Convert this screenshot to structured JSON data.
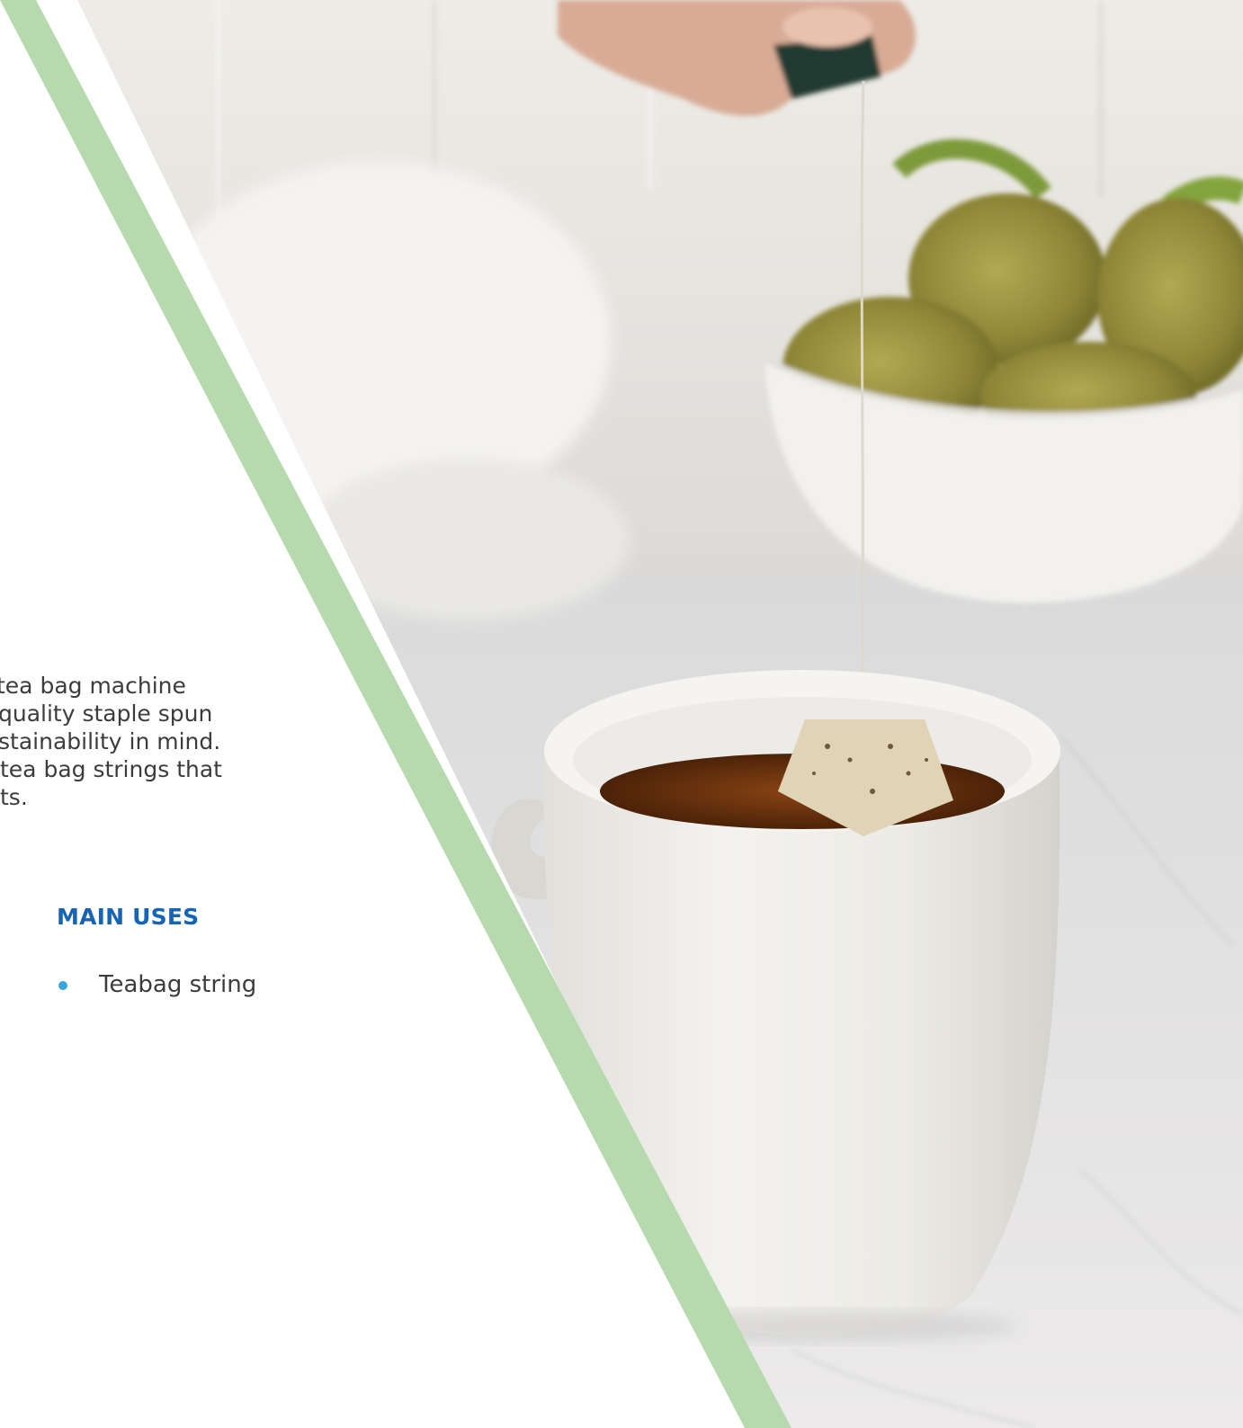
{
  "intro": {
    "lines": [
      "tea bag machine",
      "quality staple spun",
      "stainability in mind.",
      "tea bag strings that",
      "ts."
    ]
  },
  "main_uses": {
    "heading": "MAIN USES",
    "items": [
      {
        "label": "Teabag string"
      }
    ]
  },
  "colors": {
    "accent_band": "#b6d9ad",
    "heading": "#1565b4",
    "bullet": "#36a6dd",
    "body_text": "#3c3c3c"
  },
  "photo": {
    "icon": "tea-cup-photo"
  }
}
